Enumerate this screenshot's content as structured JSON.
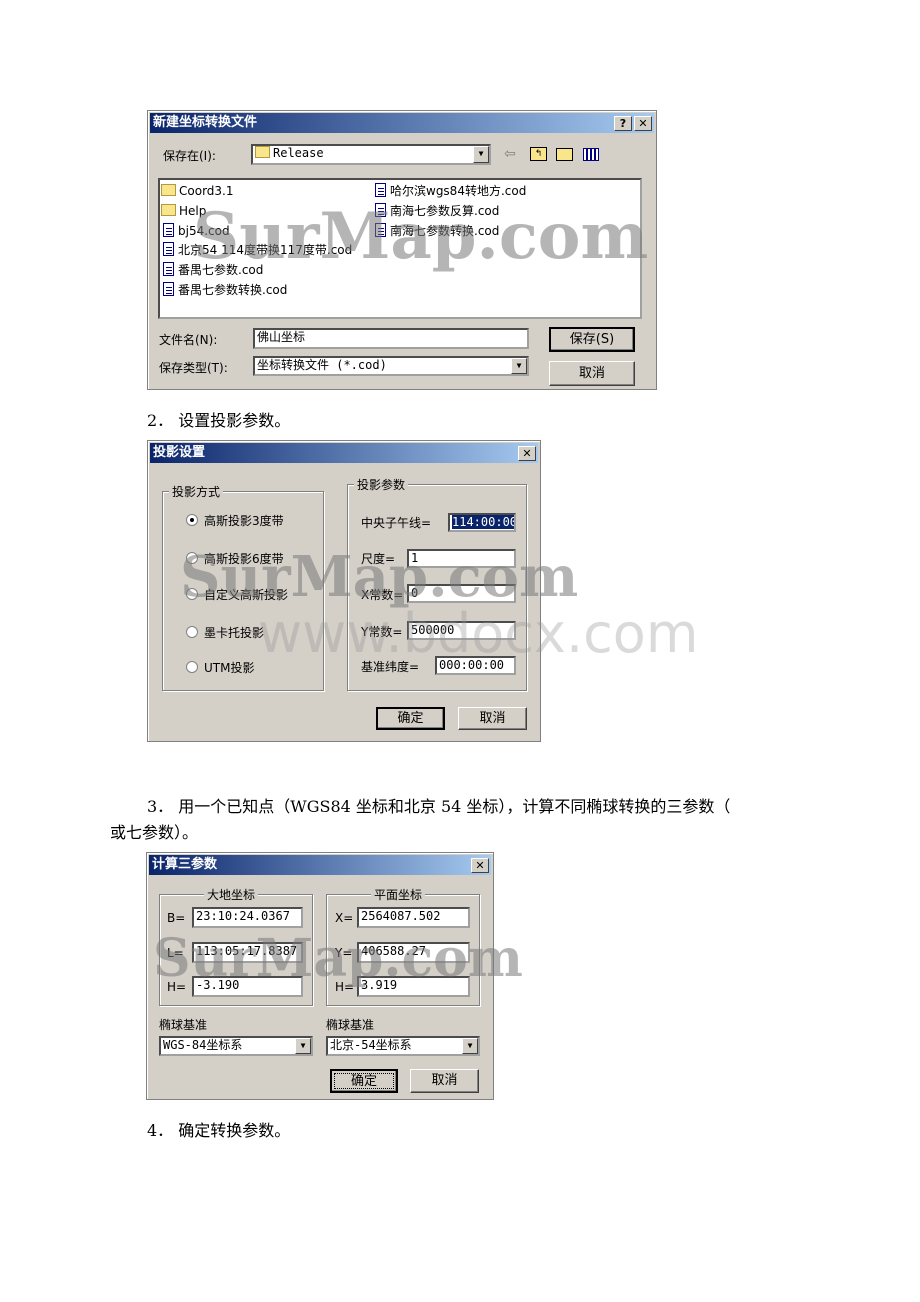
{
  "dialog_save": {
    "title": "新建坐标转换文件",
    "help_label": "?",
    "close_label": "✕",
    "save_in_label": "保存在(I):",
    "folder": "Release",
    "files_left": [
      {
        "name": "Coord3.1",
        "type": "folder"
      },
      {
        "name": "Help",
        "type": "folder"
      },
      {
        "name": "bj54.cod",
        "type": "file"
      },
      {
        "name": "北京54 114度带换117度带.cod",
        "type": "file"
      },
      {
        "name": "番禺七参数.cod",
        "type": "file"
      },
      {
        "name": "番禺七参数转换.cod",
        "type": "file"
      }
    ],
    "files_right": [
      {
        "name": "哈尔滨wgs84转地方.cod",
        "type": "file"
      },
      {
        "name": "南海七参数反算.cod",
        "type": "file"
      },
      {
        "name": "南海七参数转换.cod",
        "type": "file"
      }
    ],
    "filename_label": "文件名(N):",
    "filename_value": "佛山坐标",
    "filetype_label": "保存类型(T):",
    "filetype_value": "坐标转换文件 (*.cod)",
    "save_button": "保存(S)",
    "cancel_button": "取消",
    "toolbar_icons": [
      "back-arrow-icon",
      "up-folder-icon",
      "new-folder-icon",
      "view-menu-icon"
    ]
  },
  "step2": "2． 设置投影参数。",
  "dialog_projection": {
    "title": "投影设置",
    "close_label": "✕",
    "method_group": "投影方式",
    "methods": [
      {
        "label": "高斯投影3度带",
        "selected": true
      },
      {
        "label": "高斯投影6度带",
        "selected": false
      },
      {
        "label": "自定义高斯投影",
        "selected": false
      },
      {
        "label": "墨卡托投影",
        "selected": false
      },
      {
        "label": "UTM投影",
        "selected": false
      }
    ],
    "param_group": "投影参数",
    "params": [
      {
        "label": "中央子午线=",
        "value": "114:00:00"
      },
      {
        "label": "尺度=",
        "value": "1"
      },
      {
        "label": "X常数=",
        "value": "0"
      },
      {
        "label": "Y常数=",
        "value": "500000"
      },
      {
        "label": "基准纬度=",
        "value": "000:00:00"
      }
    ],
    "ok_button": "确定",
    "cancel_button": "取消"
  },
  "step3_line1": "3． 用一个已知点（WGS84 坐标和北京 54 坐标），计算不同椭球转换的三参数（",
  "step3_line2": "或七参数）。",
  "dialog_three_params": {
    "title": "计算三参数",
    "close_label": "✕",
    "geodetic_group": "大地坐标",
    "geodetic": [
      {
        "label": "B=",
        "value": "23:10:24.0367"
      },
      {
        "label": "L=",
        "value": "113:05:17.8387"
      },
      {
        "label": "H=",
        "value": "-3.190"
      }
    ],
    "plane_group": "平面坐标",
    "plane": [
      {
        "label": "X=",
        "value": "2564087.502"
      },
      {
        "label": "Y=",
        "value": "406588.27"
      },
      {
        "label": "H=",
        "value": "3.919"
      }
    ],
    "ellipsoid_label_left": "椭球基准",
    "ellipsoid_left": "WGS-84坐标系",
    "ellipsoid_label_right": "椭球基准",
    "ellipsoid_right": "北京-54坐标系",
    "ok_button": "确定",
    "cancel_button": "取消"
  },
  "step4": "4． 确定转换参数。",
  "watermark_surmap": "SurMap.com",
  "watermark_bdocx": "www.bdocx.com",
  "colors": {
    "title_bar_start": "#0a246a",
    "title_bar_end": "#a6caf0",
    "dialog_bg": "#d4d0c8"
  }
}
